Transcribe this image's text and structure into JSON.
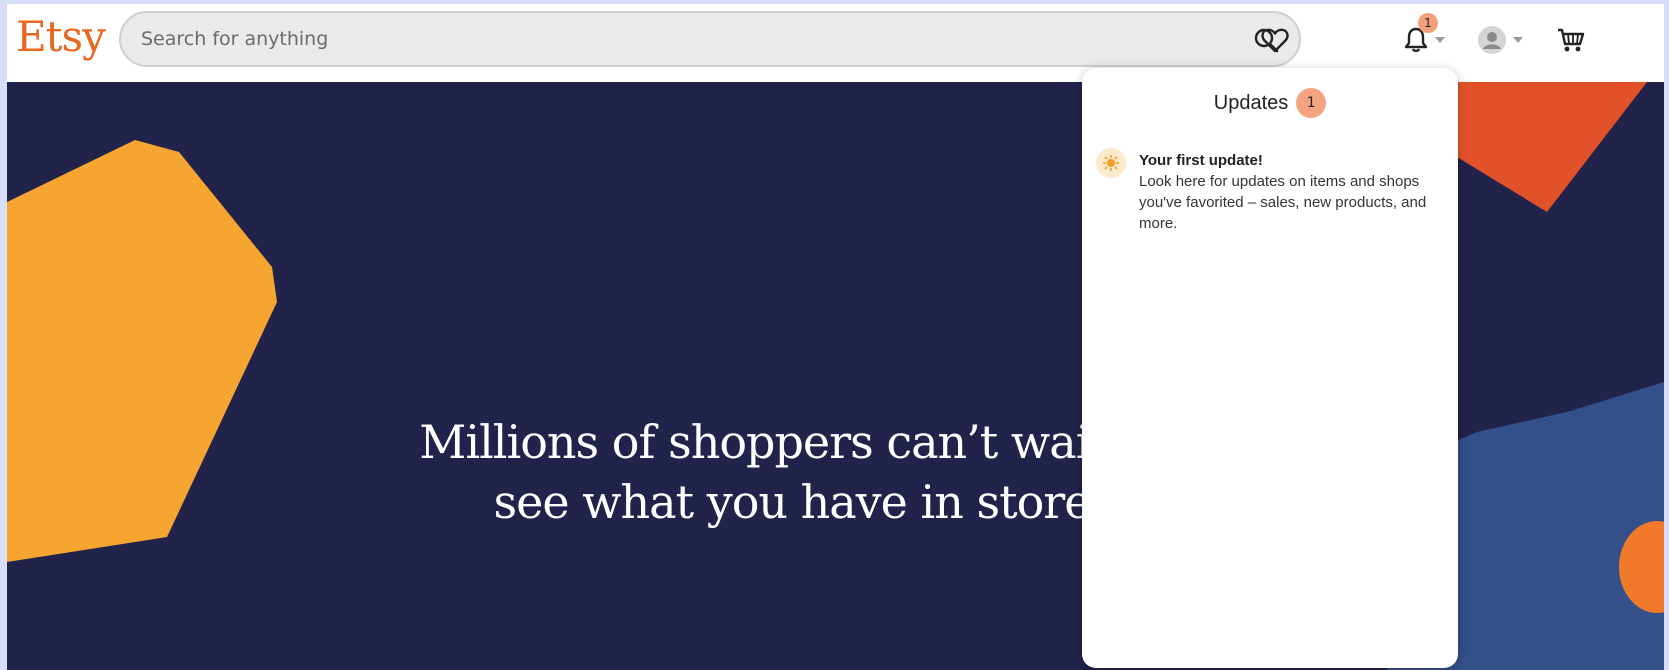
{
  "header": {
    "logo": "Etsy",
    "search": {
      "placeholder": "Search for anything"
    },
    "notifications_count": "1"
  },
  "hero": {
    "line1": "Millions of shoppers can’t wait to",
    "line2": "see what you have in store"
  },
  "updates_panel": {
    "title": "Updates",
    "count": "1",
    "items": [
      {
        "heading": "Your first update!",
        "body": "Look here for updates on items and shops you've favorited – sales, new products, and more."
      }
    ]
  },
  "colors": {
    "brand": "#e8661f",
    "hero_bg": "#22234a",
    "badge": "#f4a381",
    "shape_yellow": "#f6a531",
    "shape_orange": "#e2522a",
    "shape_blue": "#33508a"
  }
}
